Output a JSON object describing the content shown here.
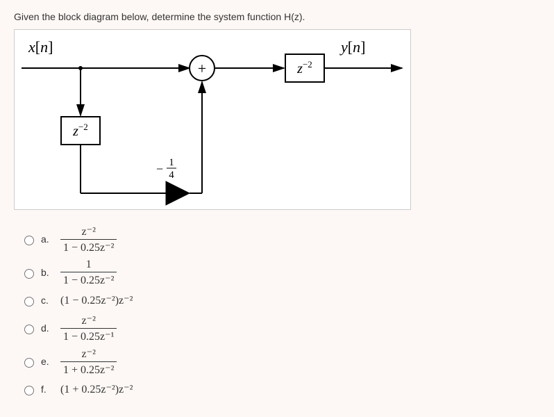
{
  "question": "Given the block diagram below, determine the system function H(z).",
  "diagram": {
    "input_label": "x[n]",
    "output_label": "y[n]",
    "sum_symbol": "+",
    "block_top_right": "z⁻²",
    "block_left": "z⁻²",
    "gain_label": "−¼"
  },
  "options": {
    "a": {
      "letter": "a.",
      "num": "z⁻²",
      "den": "1 − 0.25z⁻²",
      "inline": ""
    },
    "b": {
      "letter": "b.",
      "num": "1",
      "den": "1 − 0.25z⁻²",
      "inline": ""
    },
    "c": {
      "letter": "c.",
      "num": "",
      "den": "",
      "inline": "(1 − 0.25z⁻²)z⁻²"
    },
    "d": {
      "letter": "d.",
      "num": "z⁻²",
      "den": "1 − 0.25z⁻¹",
      "inline": ""
    },
    "e": {
      "letter": "e.",
      "num": "z⁻²",
      "den": "1 + 0.25z⁻²",
      "inline": ""
    },
    "f": {
      "letter": "f.",
      "num": "",
      "den": "",
      "inline": "(1 + 0.25z⁻²)z⁻²"
    }
  }
}
